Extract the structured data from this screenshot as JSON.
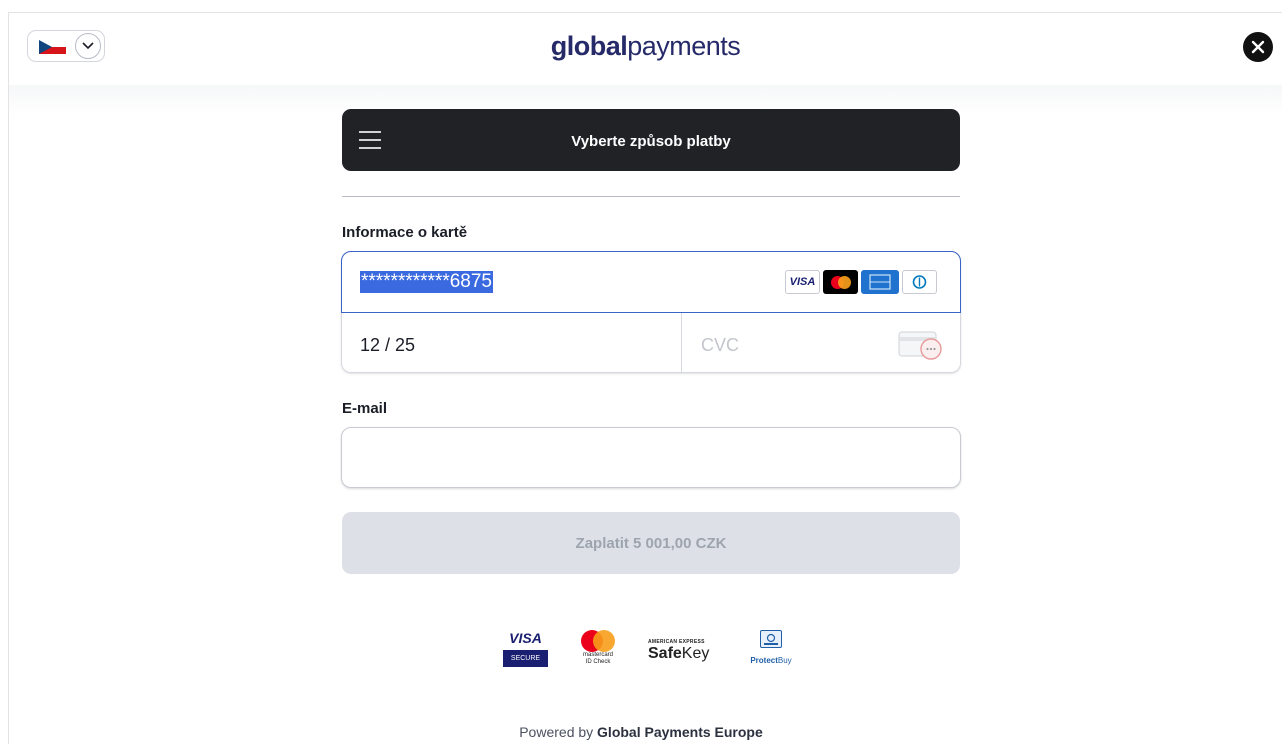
{
  "header": {
    "language": "Čeština",
    "brand_bold": "global",
    "brand_light": "payments"
  },
  "payment_method": {
    "title": "Vyberte způsob platby"
  },
  "card_section": {
    "label": "Informace o kartě",
    "card_number": "************6875",
    "expiry": "12 / 25",
    "cvc_placeholder": "CVC",
    "card_brands": [
      "visa-logo",
      "mastercard-logo",
      "amex-logo",
      "diners-logo"
    ],
    "brand_visa": "VISA"
  },
  "email_section": {
    "label": "E-mail",
    "value": "",
    "placeholder": ""
  },
  "pay_button": {
    "label": "Zaplatit 5 001,00 CZK",
    "state": "disabled"
  },
  "trust_badges": {
    "visa_word": "VISA",
    "visa_band": "SECURE",
    "mc_line1": "mastercard",
    "mc_line2": "ID Check",
    "amex_top": "AMERICAN EXPRESS",
    "amex_safe": "Safe",
    "amex_key": "Key",
    "protect_bold": "Protect",
    "protect_light": "Buy"
  },
  "footer": {
    "powered_prefix": "Powered by",
    "powered_company": "Global Payments Europe"
  },
  "colors": {
    "brand_navy": "#262a69",
    "method_bar": "#202226",
    "selection_blue": "#3b6ae0",
    "focus_border": "#3a64c7",
    "button_disabled": "#dde1e7",
    "button_disabled_text": "#9ea4ae"
  }
}
